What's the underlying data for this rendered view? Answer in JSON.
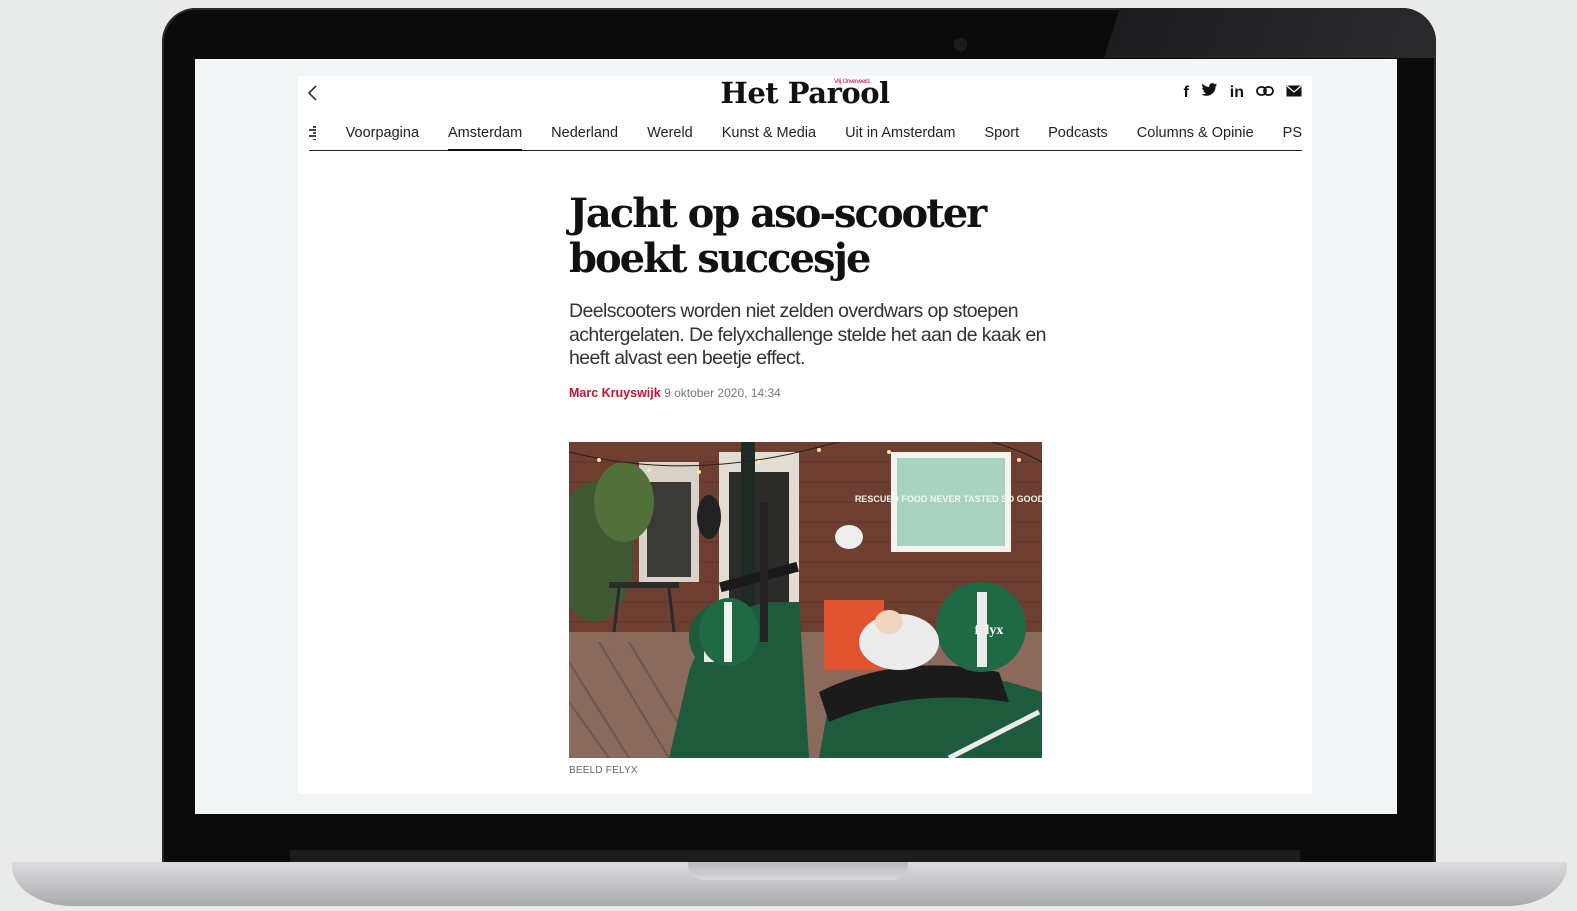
{
  "site": {
    "logo": "Het Parool",
    "logo_tag": "Vrij. Onverveerd."
  },
  "nav": {
    "items": [
      {
        "label": "Voorpagina",
        "active": false
      },
      {
        "label": "Amsterdam",
        "active": true
      },
      {
        "label": "Nederland",
        "active": false
      },
      {
        "label": "Wereld",
        "active": false
      },
      {
        "label": "Kunst & Media",
        "active": false
      },
      {
        "label": "Uit in Amsterdam",
        "active": false
      },
      {
        "label": "Sport",
        "active": false
      },
      {
        "label": "Podcasts",
        "active": false
      },
      {
        "label": "Columns & Opinie",
        "active": false
      },
      {
        "label": "PS",
        "active": false
      }
    ]
  },
  "social": {
    "facebook": "f",
    "linkedin": "in"
  },
  "article": {
    "headline": "Jacht op aso-scooter boekt succesje",
    "intro": "Deelscooters worden niet zelden overdwars op stoepen achtergelaten. De felyxchallenge stelde het aan de kaak en heeft alvast een beetje effect.",
    "author": "Marc Kruyswijk",
    "date": "9 oktober 2020, 14:34",
    "photo": {
      "sign_text": "RESCUED FOOD NEVER TASTED SO GOOD!",
      "brand_text": "felyx",
      "caption": "BEELD FELYX"
    }
  },
  "colors": {
    "accent": "#c8102e",
    "text": "#111111",
    "scooter_green": "#1e5a3c"
  }
}
